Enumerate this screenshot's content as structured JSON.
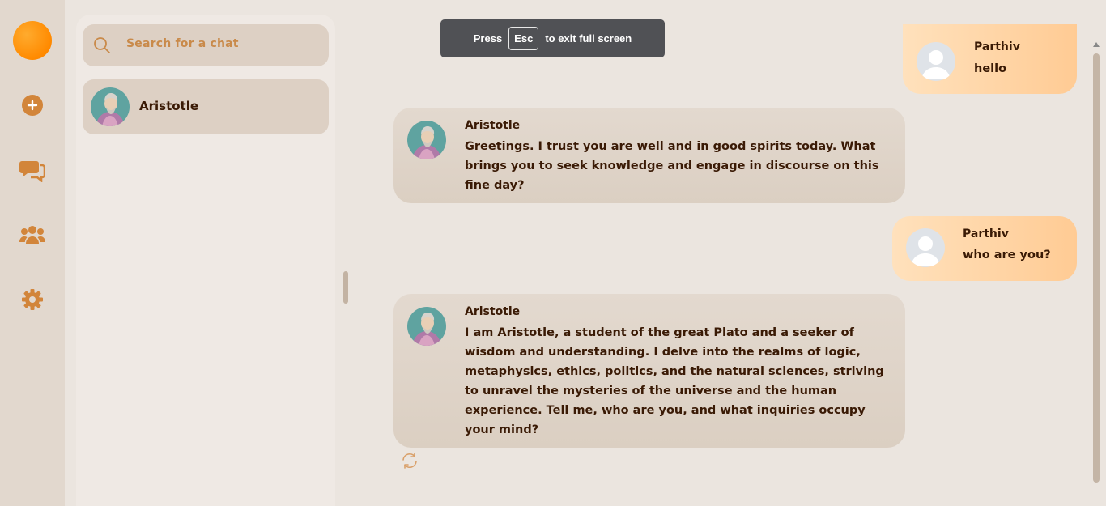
{
  "sidebar": {
    "icons": [
      "logo",
      "plus-circle-icon",
      "chat-icon",
      "users-icon",
      "gear-icon"
    ]
  },
  "search": {
    "placeholder": "Search for a chat"
  },
  "chats": [
    {
      "name": "Aristotle"
    }
  ],
  "fullscreen_toast": {
    "press": "Press",
    "key": "Esc",
    "rest": "to exit full screen"
  },
  "messages": [
    {
      "role": "user",
      "sender": "Parthiv",
      "text": "hello"
    },
    {
      "role": "bot",
      "sender": "Aristotle",
      "text": "Greetings. I trust you are well and in good spirits today. What brings you to seek knowledge and engage in discourse on this fine day?"
    },
    {
      "role": "user",
      "sender": "Parthiv",
      "text": "who are you?"
    },
    {
      "role": "bot",
      "sender": "Aristotle",
      "text": "I am Aristotle, a student of the great Plato and a seeker of wisdom and understanding. I delve into the realms of logic, metaphysics, ethics, politics, and the natural sciences, striving to unravel the mysteries of the universe and the human experience.  Tell me, who are you, and what inquiries occupy your mind?"
    }
  ],
  "colors": {
    "accent": "#d2853a",
    "user_bubble": "#ffd4a4",
    "bot_bubble": "#ddd1c5",
    "text_dark": "#3a1a05"
  }
}
